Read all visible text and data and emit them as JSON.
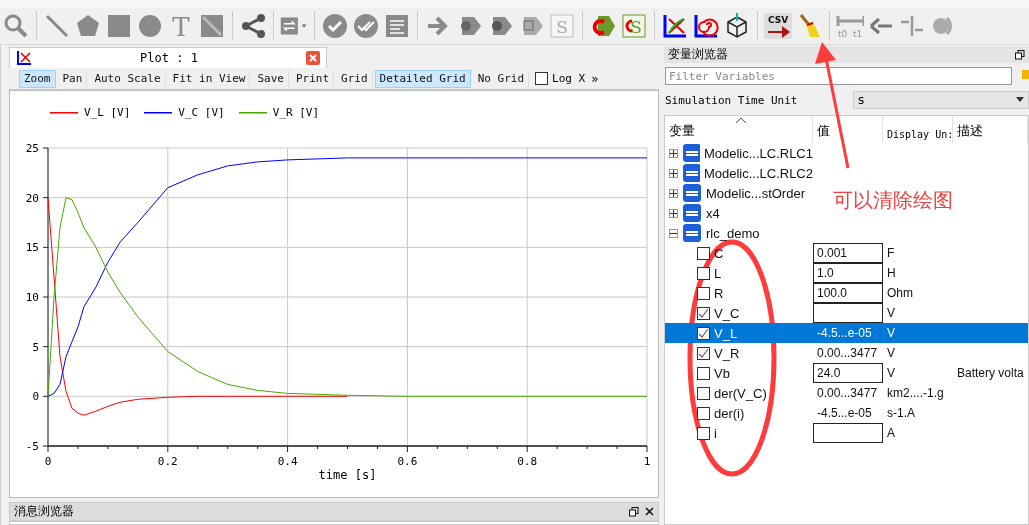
{
  "toolbar": {
    "text_tool_label": "T",
    "s_label": "S",
    "s_reload_label": "S",
    "csv_label": "CSV",
    "t0_label": "t0",
    "t1_label": "t1"
  },
  "plot_window": {
    "title": "Plot : 1",
    "buttons": [
      {
        "label": "Zoom",
        "selected": true
      },
      {
        "label": "Pan",
        "selected": false
      },
      {
        "label": "Auto Scale",
        "selected": false
      },
      {
        "label": "Fit in View",
        "selected": false
      },
      {
        "label": "Save",
        "selected": false
      },
      {
        "label": "Print",
        "selected": false
      },
      {
        "label": "Grid",
        "selected": false
      },
      {
        "label": "Detailed Grid",
        "selected": true
      },
      {
        "label": "No Grid",
        "selected": false
      }
    ],
    "log_x": {
      "label": "Log X",
      "checked": false
    },
    "overflow": "»",
    "chart_data": {
      "type": "line",
      "xlabel": "time [s]",
      "x": [
        0,
        0.01,
        0.02,
        0.03,
        0.04,
        0.05,
        0.06,
        0.08,
        0.1,
        0.12,
        0.15,
        0.2,
        0.25,
        0.3,
        0.35,
        0.4,
        0.5,
        0.6,
        0.7,
        0.8,
        0.9,
        1
      ],
      "series": [
        {
          "name": "V_L [V]",
          "color": "#ff0000",
          "values": [
            20,
            12,
            4,
            0.5,
            -1.2,
            -1.7,
            -1.9,
            -1.5,
            -1,
            -0.6,
            -0.3,
            -0.1,
            0,
            0,
            0,
            0,
            0,
            null,
            null,
            null,
            null,
            null
          ]
        },
        {
          "name": "V_C [V]",
          "color": "#0000ff",
          "values": [
            0,
            0.3,
            1.2,
            4,
            5.5,
            7,
            9,
            11,
            13.5,
            15.5,
            17.5,
            21,
            22.3,
            23.2,
            23.6,
            23.8,
            24,
            24,
            24,
            24,
            24,
            24
          ]
        },
        {
          "name": "V_R [V]",
          "color": "#44aa00",
          "values": [
            0,
            10,
            17,
            20,
            19.8,
            18.5,
            17,
            15,
            12.5,
            10.5,
            8,
            4.5,
            2.5,
            1.2,
            0.6,
            0.3,
            0.1,
            0,
            0,
            0,
            0,
            0
          ]
        }
      ],
      "grid": true,
      "xlim": [
        0,
        1
      ],
      "ylim": [
        -5,
        25
      ],
      "xticks": [
        0,
        0.2,
        0.4,
        0.6,
        0.8,
        1
      ],
      "yticks": [
        -5,
        0,
        5,
        10,
        15,
        20,
        25
      ]
    }
  },
  "message_browser": {
    "title": "消息浏览器"
  },
  "variables_browser": {
    "title": "变量浏览器",
    "filter_placeholder": "Filter Variables",
    "time_unit_label": "Simulation Time Unit",
    "time_unit": "s",
    "columns": [
      "变量",
      "值",
      "Display Un:",
      "描述"
    ],
    "tree": [
      {
        "name": "Modelic...LC.RLC1",
        "expanded": false
      },
      {
        "name": "Modelic...LC.RLC2",
        "expanded": false
      },
      {
        "name": "Modelic...stOrder",
        "expanded": false
      },
      {
        "name": "x4",
        "expanded": false
      },
      {
        "name": "rlc_demo",
        "expanded": true,
        "children": [
          {
            "name": "C",
            "checked": false,
            "selected": false,
            "editable": true,
            "value": "0.001",
            "unit": "F"
          },
          {
            "name": "L",
            "checked": false,
            "selected": false,
            "editable": true,
            "value": "1.0",
            "unit": "H"
          },
          {
            "name": "R",
            "checked": false,
            "selected": false,
            "editable": true,
            "value": "100.0",
            "unit": "Ohm"
          },
          {
            "name": "V_C",
            "checked": true,
            "selected": false,
            "editable": true,
            "unit": "V"
          },
          {
            "name": "V_L",
            "checked": true,
            "selected": true,
            "editable": false,
            "value": "-4.5...e-05",
            "unit": "V"
          },
          {
            "name": "V_R",
            "checked": true,
            "selected": false,
            "editable": false,
            "value": "0.00...3477",
            "unit": "V"
          },
          {
            "name": "Vb",
            "checked": false,
            "selected": false,
            "editable": true,
            "value": "24.0",
            "unit": "V",
            "description": "Battery volta"
          },
          {
            "name": "der(V_C)",
            "checked": false,
            "selected": false,
            "editable": false,
            "value": "0.00...3477",
            "unit": "km2....-1.g"
          },
          {
            "name": "der(i)",
            "checked": false,
            "selected": false,
            "editable": false,
            "value": "-4.5...e-05",
            "unit": "s-1.A"
          },
          {
            "name": "i",
            "checked": false,
            "selected": false,
            "editable": true,
            "unit": "A"
          }
        ]
      }
    ]
  },
  "annotation": {
    "text": "可以清除绘图"
  }
}
